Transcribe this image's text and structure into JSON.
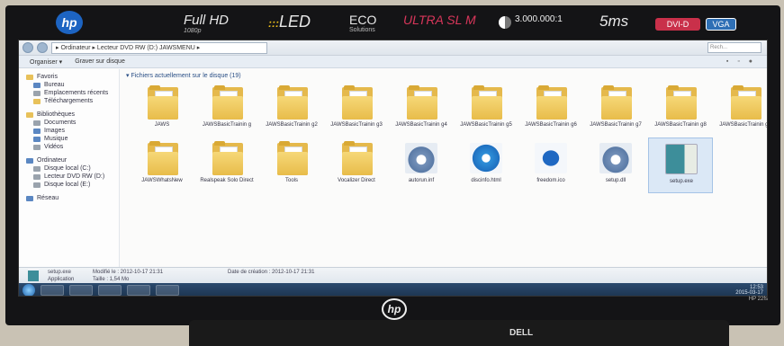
{
  "monitor": {
    "brand": "hp",
    "badges": {
      "fullhd": "Full HD",
      "fullhd_sub": "1080p",
      "led": "LED",
      "eco": "ECO",
      "eco_sub": "Solutions",
      "ultra": "ULTRA SL M",
      "contrast": "3.000.000:1",
      "response": "5ms",
      "dvi": "DVI-D",
      "vga": "VGA"
    },
    "chin_logo": "hp",
    "model": "HP 22fs"
  },
  "explorer": {
    "address": "▸ Ordinateur ▸ Lecteur DVD RW (D:) JAWSMENU ▸",
    "search_placeholder": "Rech...",
    "toolbar": {
      "organize": "Organiser ▾",
      "burn": "Graver sur disque"
    },
    "nav": {
      "favorites": "Favoris",
      "desktop": "Bureau",
      "recent": "Emplacements récents",
      "downloads": "Téléchargements",
      "libraries": "Bibliothèques",
      "documents": "Documents",
      "images": "Images",
      "music": "Musique",
      "videos": "Vidéos",
      "computer": "Ordinateur",
      "local_c": "Disque local (C:)",
      "dvd_d": "Lecteur DVD RW (D:)",
      "local_e": "Disque local (E:)",
      "network": "Réseau"
    },
    "section_header": "▾ Fichiers actuellement sur le disque (19)",
    "files": [
      {
        "label": "JAWS",
        "kind": "folder"
      },
      {
        "label": "JAWSBasicTrainin g",
        "kind": "folder"
      },
      {
        "label": "JAWSBasicTrainin g2",
        "kind": "folder"
      },
      {
        "label": "JAWSBasicTrainin g3",
        "kind": "folder"
      },
      {
        "label": "JAWSBasicTrainin g4",
        "kind": "folder"
      },
      {
        "label": "JAWSBasicTrainin g5",
        "kind": "folder"
      },
      {
        "label": "JAWSBasicTrainin g6",
        "kind": "folder"
      },
      {
        "label": "JAWSBasicTrainin g7",
        "kind": "folder"
      },
      {
        "label": "JAWSBasicTrainin g8",
        "kind": "folder"
      },
      {
        "label": "JAWSBasicTrainin g9",
        "kind": "folder"
      },
      {
        "label": "JAWSWhatsNew",
        "kind": "folder"
      },
      {
        "label": "Realspeak Solo Direct",
        "kind": "folder"
      },
      {
        "label": "Tools",
        "kind": "folder"
      },
      {
        "label": "Vocalizer Direct",
        "kind": "folder"
      },
      {
        "label": "autorun.inf",
        "kind": "gear"
      },
      {
        "label": "discinfo.html",
        "kind": "ie"
      },
      {
        "label": "freedom.ico",
        "kind": "logo"
      },
      {
        "label": "setup.dll",
        "kind": "gear"
      },
      {
        "label": "setup.exe",
        "kind": "setup"
      }
    ],
    "details": {
      "name": "setup.exe",
      "type": "Application",
      "modified": "Modifié le : 2012-10-17 21:31",
      "size": "Taille : 1,54 Mo",
      "created": "Date de création : 2012-10-17 21:31"
    },
    "tray": {
      "time": "12:53",
      "date": "2015-03-17"
    }
  },
  "keyboard_brand": "DELL"
}
